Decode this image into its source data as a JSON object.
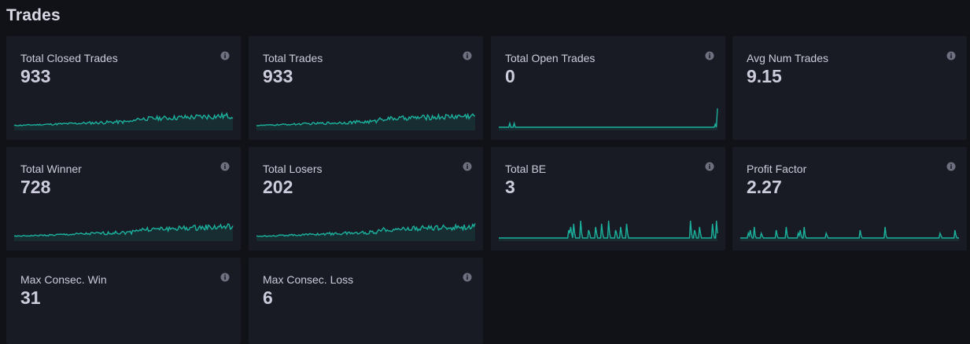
{
  "page": {
    "title": "Trades"
  },
  "colors": {
    "background": "#111217",
    "panel": "#181b24",
    "text": "#ccccdc",
    "sparkline": "#1bb19d",
    "icon": "#6e7080"
  },
  "panels": [
    {
      "title": "Total Closed Trades",
      "value": "933",
      "icon": "info-icon",
      "sparkline": "growing-noise"
    },
    {
      "title": "Total Trades",
      "value": "933",
      "icon": "info-icon",
      "sparkline": "growing-noise"
    },
    {
      "title": "Total Open Trades",
      "value": "0",
      "icon": "info-icon",
      "sparkline": "rare-spikes-end"
    },
    {
      "title": "Avg Num Trades",
      "value": "9.15",
      "icon": "info-icon",
      "sparkline": "none"
    },
    {
      "title": "Total Winner",
      "value": "728",
      "icon": "info-icon",
      "sparkline": "growing-noise"
    },
    {
      "title": "Total Losers",
      "value": "202",
      "icon": "info-icon",
      "sparkline": "growing-noise"
    },
    {
      "title": "Total BE",
      "value": "3",
      "icon": "info-icon",
      "sparkline": "spikes"
    },
    {
      "title": "Profit Factor",
      "value": "2.27",
      "icon": "info-icon",
      "sparkline": "spikes-left"
    },
    {
      "title": "Max Consec. Win",
      "value": "31",
      "icon": "info-icon",
      "sparkline": "none"
    },
    {
      "title": "Max Consec. Loss",
      "value": "6",
      "icon": "info-icon",
      "sparkline": "none"
    }
  ]
}
